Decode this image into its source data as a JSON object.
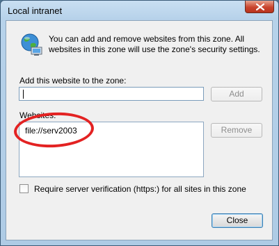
{
  "window": {
    "title": "Local intranet"
  },
  "intro": "You can add and remove websites from this zone. All websites in this zone will use the zone's security settings.",
  "add_section": {
    "label": "Add this website to the zone:",
    "input_value": "",
    "add_button": "Add"
  },
  "websites_section": {
    "label": "Websites:",
    "items": [
      "file://serv2003"
    ],
    "remove_button": "Remove"
  },
  "checkbox": {
    "label": "Require server verification (https:) for all sites in this zone",
    "checked": false
  },
  "footer": {
    "close_button": "Close"
  },
  "icons": {
    "zone": "globe-with-network-icon",
    "window_close": "close-icon"
  },
  "colors": {
    "annotation_ring": "#e32222",
    "title_bar": "#b7d2ea"
  }
}
